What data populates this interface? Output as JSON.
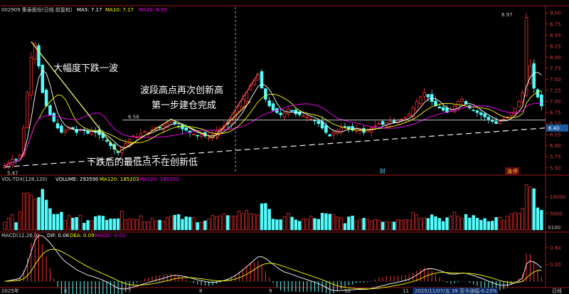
{
  "price_header": {
    "code_name": "002909 集泰股份(日线 前复权)",
    "ma5": "MA5: 7.17",
    "ma10": "MA10: 7.17",
    "ma20": "MA20: 6.95"
  },
  "volume_header": {
    "name": "VOL-TDX(128,120)",
    "volume": "VOLUME: 293590",
    "ma120": "MA120: 185203",
    "ma120b": "MA120: 185203"
  },
  "macd_header": {
    "name": "MACD(12,26,9)",
    "dif": "DIF: 0.08",
    "dea": "DEA: 0.09",
    "macd": "MACD: -0.01"
  },
  "annotations": {
    "big_drop": "大幅度下跌一波",
    "new_high_1": "波段高点再次创新高",
    "new_high_2": "第一步建仓完成",
    "no_new_low": "下跌后的最低点不在创新低",
    "level_label": "6.58",
    "peak_label": "8.97",
    "low_label": "5.47",
    "current_price": "6.40",
    "mark_cai": "财",
    "mark_zhang": "涨",
    "mark_ting": "停"
  },
  "x_axis": {
    "left_label": "2025年",
    "months": [
      "6",
      "7",
      "8",
      "9",
      "10",
      "11"
    ],
    "status": "2025/11/07/五 39 至今涨幅-0.23%",
    "right_label": "日线"
  },
  "colors": {
    "up": "#ff3232",
    "down": "#54fcfc",
    "ma5": "#ffffff",
    "ma10": "#ffff00",
    "ma20": "#ff00ff",
    "trend_line": "#e8e860"
  },
  "chart_data": [
    {
      "type": "candlestick",
      "title": "002909 集泰股份(日线 前复权)",
      "ylim": [
        5.4,
        9.1
      ],
      "y_ticks": [
        5.5,
        5.75,
        6.0,
        6.25,
        6.5,
        6.75,
        7.0,
        7.25,
        7.5,
        7.75,
        8.0,
        8.25,
        8.5,
        8.75,
        9.0
      ],
      "x_labels": [
        "2025年",
        "6",
        "7",
        "8",
        "9",
        "10",
        "11"
      ],
      "series": [
        {
          "name": "MA5",
          "value": 7.17
        },
        {
          "name": "MA10",
          "value": 7.17
        },
        {
          "name": "MA20",
          "value": 6.95
        }
      ],
      "close": [
        5.55,
        5.62,
        5.7,
        5.68,
        5.8,
        6.4,
        7.2,
        8.0,
        8.3,
        7.8,
        7.2,
        6.9,
        6.7,
        6.55,
        6.4,
        6.3,
        6.35,
        6.42,
        6.38,
        6.3,
        6.36,
        6.34,
        6.28,
        6.35,
        6.3,
        6.25,
        6.18,
        6.1,
        6.0,
        5.92,
        5.85,
        5.96,
        6.05,
        6.15,
        6.22,
        6.2,
        6.28,
        6.32,
        6.3,
        6.36,
        6.42,
        6.4,
        6.46,
        6.52,
        6.58,
        6.5,
        6.44,
        6.38,
        6.35,
        6.3,
        6.26,
        6.22,
        6.25,
        6.22,
        6.18,
        6.25,
        6.32,
        6.38,
        6.45,
        6.5,
        6.62,
        6.75,
        6.9,
        7.05,
        7.2,
        7.35,
        7.48,
        7.62,
        7.3,
        7.05,
        6.9,
        6.8,
        6.75,
        6.7,
        6.74,
        6.82,
        6.78,
        6.72,
        6.7,
        6.68,
        6.65,
        6.6,
        6.56,
        6.5,
        6.4,
        6.3,
        6.22,
        6.3,
        6.35,
        6.4,
        6.42,
        6.38,
        6.35,
        6.4,
        6.36,
        6.3,
        6.35,
        6.4,
        6.45,
        6.5,
        6.48,
        6.52,
        6.55,
        6.52,
        6.58,
        6.6,
        6.65,
        6.72,
        6.85,
        7.0,
        7.1,
        7.2,
        7.1,
        7.0,
        6.9,
        6.85,
        6.8,
        6.75,
        6.8,
        6.9,
        7.0,
        7.05,
        6.95,
        6.85,
        6.8,
        6.75,
        6.7,
        6.65,
        6.6,
        6.55,
        6.5,
        6.55,
        6.6,
        6.65,
        6.75,
        6.85,
        7.0,
        7.2,
        8.9,
        7.8,
        7.3,
        7.1,
        6.9
      ],
      "annotations": [
        {
          "text": "大幅度下跌一波"
        },
        {
          "text": "波段高点再次创新高"
        },
        {
          "text": "第一步建仓完成"
        },
        {
          "text": "下跌后的最低点不在创新低"
        },
        {
          "text": "6.58"
        },
        {
          "text": "8.97"
        },
        {
          "text": "5.47"
        },
        {
          "text": "6.40"
        }
      ]
    },
    {
      "type": "bar",
      "title": "VOL-TDX(128,120)",
      "ylim": [
        0,
        14000
      ],
      "y_ticks": [
        5000,
        10000
      ],
      "unit_label": "X100",
      "series": [
        {
          "name": "VOLUME",
          "value": 293590
        },
        {
          "name": "MA120",
          "value": 185203
        }
      ]
    },
    {
      "type": "line",
      "title": "MACD(12,26,9)",
      "ylim": [
        -0.05,
        0.5
      ],
      "y_ticks": [
        0.2,
        0.4
      ],
      "series": [
        {
          "name": "DIF",
          "value": 0.08
        },
        {
          "name": "DEA",
          "value": 0.09
        },
        {
          "name": "MACD",
          "value": -0.01
        }
      ]
    }
  ]
}
